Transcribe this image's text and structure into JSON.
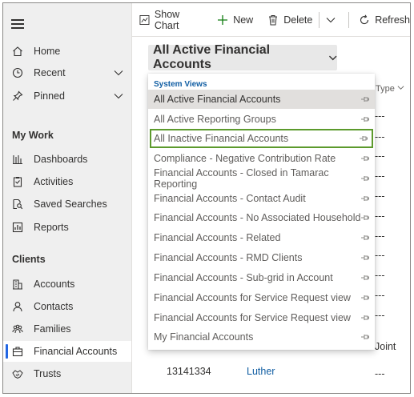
{
  "sidebar": {
    "top_items": [
      {
        "label": "Home",
        "icon": "home-icon"
      },
      {
        "label": "Recent",
        "icon": "clock-icon"
      },
      {
        "label": "Pinned",
        "icon": "pin-icon"
      }
    ],
    "groups": [
      {
        "title": "My Work",
        "items": [
          {
            "label": "Dashboards",
            "icon": "dashboard-icon"
          },
          {
            "label": "Activities",
            "icon": "clipboard-icon"
          },
          {
            "label": "Saved Searches",
            "icon": "saved-search-icon"
          },
          {
            "label": "Reports",
            "icon": "report-icon"
          }
        ]
      },
      {
        "title": "Clients",
        "items": [
          {
            "label": "Accounts",
            "icon": "building-icon"
          },
          {
            "label": "Contacts",
            "icon": "person-icon"
          },
          {
            "label": "Families",
            "icon": "people-icon"
          },
          {
            "label": "Financial Accounts",
            "icon": "briefcase-icon"
          },
          {
            "label": "Trusts",
            "icon": "handshake-icon"
          }
        ]
      }
    ]
  },
  "toolbar": {
    "show_chart": "Show Chart",
    "new": "New",
    "delete": "Delete",
    "refresh": "Refresh"
  },
  "view_selector": {
    "label": "All Active Financial Accounts"
  },
  "grid": {
    "type_header": "Type",
    "type_values": [
      "---",
      "---",
      "---",
      "---",
      "---",
      "---",
      "---",
      "---",
      "---",
      "---",
      "---",
      "Joint",
      "---"
    ],
    "last_row": {
      "id": "13141334",
      "name": "Luther",
      "type": "---"
    }
  },
  "dropdown": {
    "header": "System Views",
    "items": [
      "All Active Financial Accounts",
      "All Active Reporting Groups",
      "All Inactive Financial Accounts",
      "Compliance - Negative Contribution Rate",
      "Financial Accounts - Closed in Tamarac Reporting",
      "Financial Accounts - Contact Audit",
      "Financial Accounts - No Associated Household",
      "Financial Accounts - Related",
      "Financial Accounts - RMD Clients",
      "Financial Accounts - Sub-grid in Account",
      "Financial Accounts for Service Request view",
      "Financial Accounts for Service Request view",
      "My Financial Accounts"
    ],
    "selected_index": 0,
    "highlighted_index": 2
  }
}
